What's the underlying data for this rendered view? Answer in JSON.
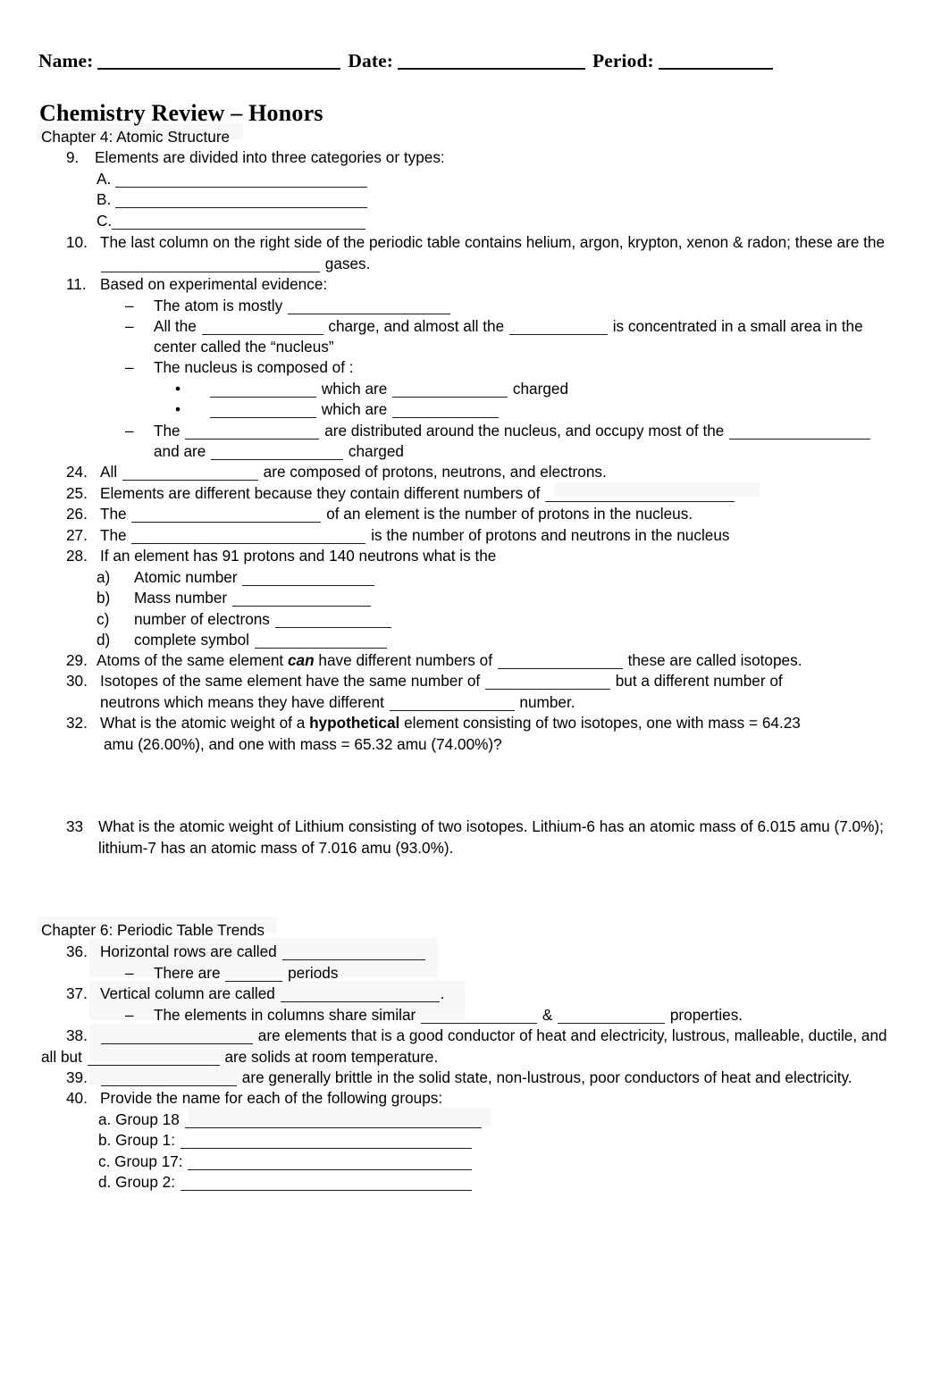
{
  "header": {
    "name_label": "Name:",
    "date_label": "Date:",
    "period_label": "Period:"
  },
  "title": "Chemistry Review – Honors",
  "chapters": {
    "ch4": "Chapter 4: Atomic Structure",
    "ch6": "Chapter 6: Periodic Table Trends"
  },
  "q9": {
    "num": "9.",
    "text": "Elements are divided into three categories or types:",
    "a_label": "A.",
    "b_label": "B.",
    "c_label": "C."
  },
  "q10": {
    "num": "10.",
    "line1": "The last column on the right side of the periodic table contains helium, argon, krypton, xenon & radon; these are the",
    "line2_tail": "gases."
  },
  "q11": {
    "num": "11.",
    "text": "Based on experimental evidence:",
    "b1": "The atom is mostly",
    "b2_a": "All the",
    "b2_b": "charge, and almost all the",
    "b2_c": "is concentrated in a small area in the",
    "b2_line2": "center called the “nucleus”",
    "b3": "The nucleus is composed of :",
    "s1_a": "which are",
    "s1_b": "charged",
    "s2_a": "which are",
    "b4_a": "The",
    "b4_b": "are distributed around the nucleus, and occupy most of the",
    "b4_line2_a": "and are",
    "b4_line2_b": "charged",
    "dash": "–",
    "bullet": "•"
  },
  "q24": {
    "num": "24.",
    "a": "All",
    "b": "are composed of protons, neutrons, and electrons."
  },
  "q25": {
    "num": "25.",
    "a": "Elements are different because they contain different numbers of"
  },
  "q26": {
    "num": "26.",
    "a": "The",
    "b": "of an element is the number of protons in the nucleus."
  },
  "q27": {
    "num": "27.",
    "a": "The",
    "b": "is the number of protons and neutrons in the nucleus"
  },
  "q28": {
    "num": "28.",
    "text": "If an element has 91 protons and 140 neutrons what is the",
    "a_label": "a)",
    "a_text": "Atomic number",
    "b_label": "b)",
    "b_text": "Mass number",
    "c_label": "c)",
    "c_text": "number of electrons",
    "d_label": "d)",
    "d_text": "complete symbol"
  },
  "q29": {
    "num": "29.",
    "a": "Atoms of the same element",
    "em": "can",
    "b": "have different numbers of",
    "c": "these are called isotopes."
  },
  "q30": {
    "num": "30.",
    "a": "Isotopes of the same element have the same number of",
    "b": "but a different number of",
    "line2_a": "neutrons which means they have different",
    "line2_b": "number."
  },
  "q32": {
    "num": "32.",
    "a": "What is the atomic weight of a",
    "em": "hypothetical",
    "b": "element consisting of two isotopes, one with mass = 64.23",
    "line2": "amu (26.00%), and one with mass = 65.32 amu (74.00%)?"
  },
  "q33": {
    "num": "33",
    "line1": "What is the atomic weight of Lithium consisting of two isotopes. Lithium-6 has an atomic mass of 6.015 amu (7.0%);",
    "line2": "lithium-7 has an atomic mass of 7.016 amu (93.0%)."
  },
  "q36": {
    "num": "36.",
    "a": "Horizontal rows are called",
    "sub_a": "There are",
    "sub_b": "periods",
    "dash": "–"
  },
  "q37": {
    "num": "37.",
    "a": "Vertical column are called",
    "period": ".",
    "sub_a": "The elements in columns share similar",
    "sub_amp": "&",
    "sub_b": "properties.",
    "dash": "–"
  },
  "q38": {
    "num": "38.",
    "a": "are elements that is a good conductor of heat and electricity, lustrous, malleable, ductile, and",
    "line2_a": "all but",
    "line2_b": "are solids at room temperature."
  },
  "q39": {
    "num": "39.",
    "a": "are generally brittle in the solid state, non-lustrous, poor conductors of heat and electricity."
  },
  "q40": {
    "num": "40.",
    "text": "Provide the name for each of the following groups:",
    "a": "a. Group 18",
    "b": "b. Group 1:",
    "c": "c. Group 17:",
    "d": "d. Group 2:"
  }
}
